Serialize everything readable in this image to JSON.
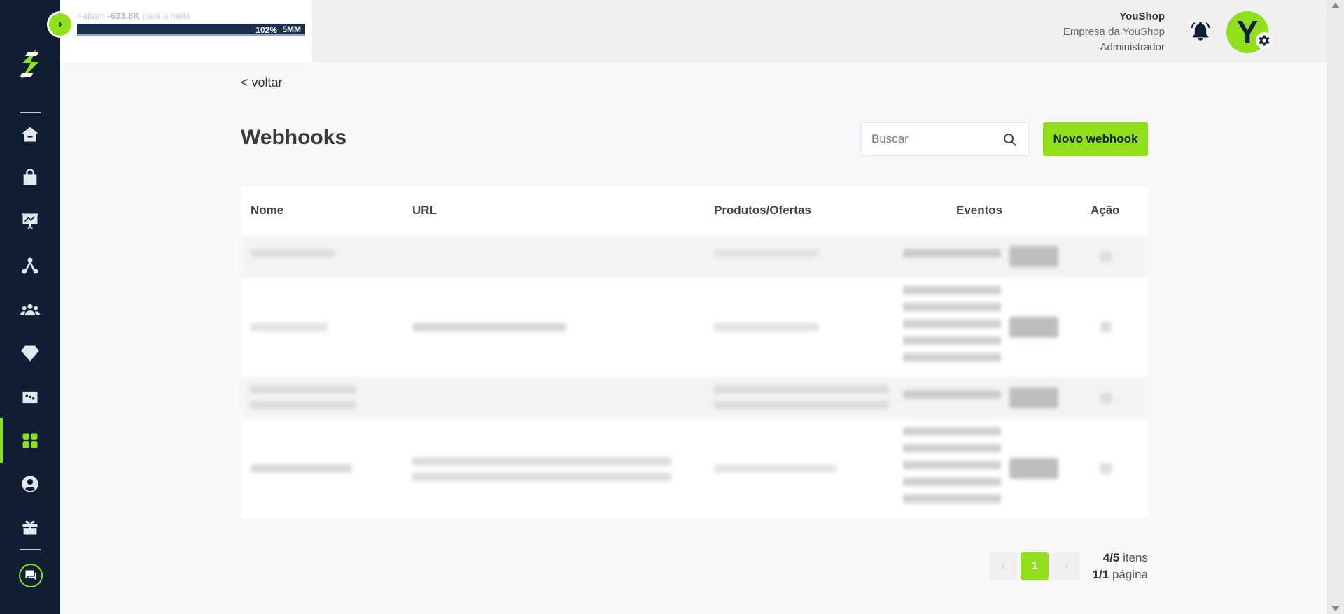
{
  "header": {
    "goal_prefix": "Faltam",
    "goal_amount": "-633.8K",
    "goal_suffix": "para a meta",
    "goal_progress_label": "102%",
    "goal_target_label": "5MM",
    "goal_progress": 1.02,
    "shop_name": "YouShop",
    "company_link": "Empresa da YouShop",
    "role": "Administrador",
    "avatar_letter": "Y"
  },
  "sidebar": {
    "items": [
      {
        "icon": "home-icon"
      },
      {
        "icon": "shopping-bag-icon"
      },
      {
        "icon": "presentation-chart-icon"
      },
      {
        "icon": "network-icon"
      },
      {
        "icon": "users-icon"
      },
      {
        "icon": "diamond-icon"
      },
      {
        "icon": "dice-icon"
      },
      {
        "icon": "apps-grid-icon",
        "active": true
      },
      {
        "icon": "user-circle-icon"
      },
      {
        "icon": "gift-icon"
      }
    ],
    "chat_icon": "chat-icon",
    "accent": "#8fe01a"
  },
  "main": {
    "back_label": "< voltar",
    "title": "Webhooks",
    "search_placeholder": "Buscar",
    "new_button": "Novo webhook",
    "columns": [
      "Nome",
      "URL",
      "Produtos/Ofertas",
      "Eventos",
      "Ação"
    ]
  },
  "pagination": {
    "current_page": "1",
    "items_count": "4/5",
    "items_label": "itens",
    "pages_count": "1/1",
    "pages_label": "página"
  },
  "colors": {
    "sidebar": "#0f1e33",
    "accent": "#8fe01a",
    "background": "#f7f8fa"
  }
}
